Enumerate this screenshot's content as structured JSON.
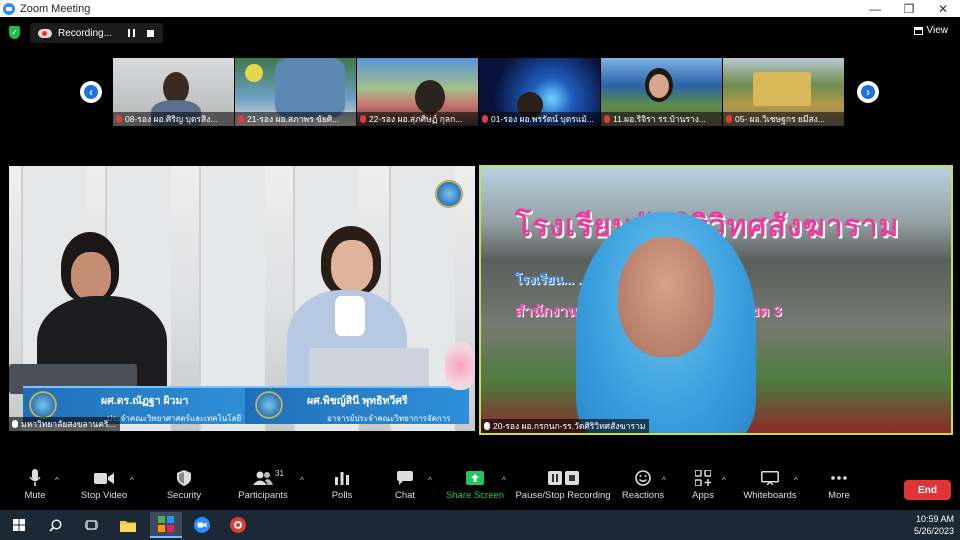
{
  "window": {
    "title": "Zoom Meeting",
    "controls": [
      "—",
      "❐",
      "✕"
    ]
  },
  "recording": {
    "label": "Recording..."
  },
  "view": {
    "label": "View"
  },
  "thumbnails": [
    {
      "name": "08-รอง ผอ.ศิริญ บุตรสิง..."
    },
    {
      "name": "21-รอง ผอ.สภาพร ขัยศิ..."
    },
    {
      "name": "22-รอง ผอ.สุภศิษฏ์ กุลก..."
    },
    {
      "name": "01-รอง ผอ.พรรัตน์ บุตรแม้..."
    },
    {
      "name": "11.ผอ.ริจิรา รร.บ้านราง..."
    },
    {
      "name": "05- ผอ.วิเชษฐกร ยมีสง..."
    }
  ],
  "left_tile": {
    "speaker1": {
      "name": "ผศ.ดร.ณัฏฐา ผิวมา",
      "title": "ประจำคณะวิทยาศาสตร์และเทคโนโลยี"
    },
    "speaker2": {
      "name": "ผศ.พิชญ์สินี พุทธิทวีศรี",
      "title": "อาจารย์ประจำคณะวิทยาการจัดการ"
    },
    "participant_name": "มหาวิทยาลัยสงขลานคริ..."
  },
  "right_tile": {
    "banner_line1": "โรงเรียนวัดศิริวิทศสังฆาราม",
    "banner_line2": "โรงเรียน...   ...โรงเรียนแนวชายแดน",
    "banner_line3": "สำนักงานเขตพื้นที่การศึกษาสงขลา เขต 3",
    "participant_name": "20-รอง ผอ.กรกนก-รร.วัดศิริวิทศสังฆาราม"
  },
  "toolbar": {
    "mute": "Mute",
    "stop_video": "Stop Video",
    "security": "Security",
    "participants": "Participants",
    "participants_count": "31",
    "polls": "Polls",
    "chat": "Chat",
    "share_screen": "Share Screen",
    "pause_stop_recording": "Pause/Stop Recording",
    "reactions": "Reactions",
    "apps": "Apps",
    "whiteboards": "Whiteboards",
    "more": "More",
    "end": "End"
  },
  "taskbar": {
    "time": "10:59 AM",
    "date": "5/26/2023"
  },
  "colors": {
    "share_green": "#22c55e",
    "end_red": "#e03438",
    "active_speaker_border": "#c6e04c",
    "zoom_blue": "#2d8cff"
  }
}
